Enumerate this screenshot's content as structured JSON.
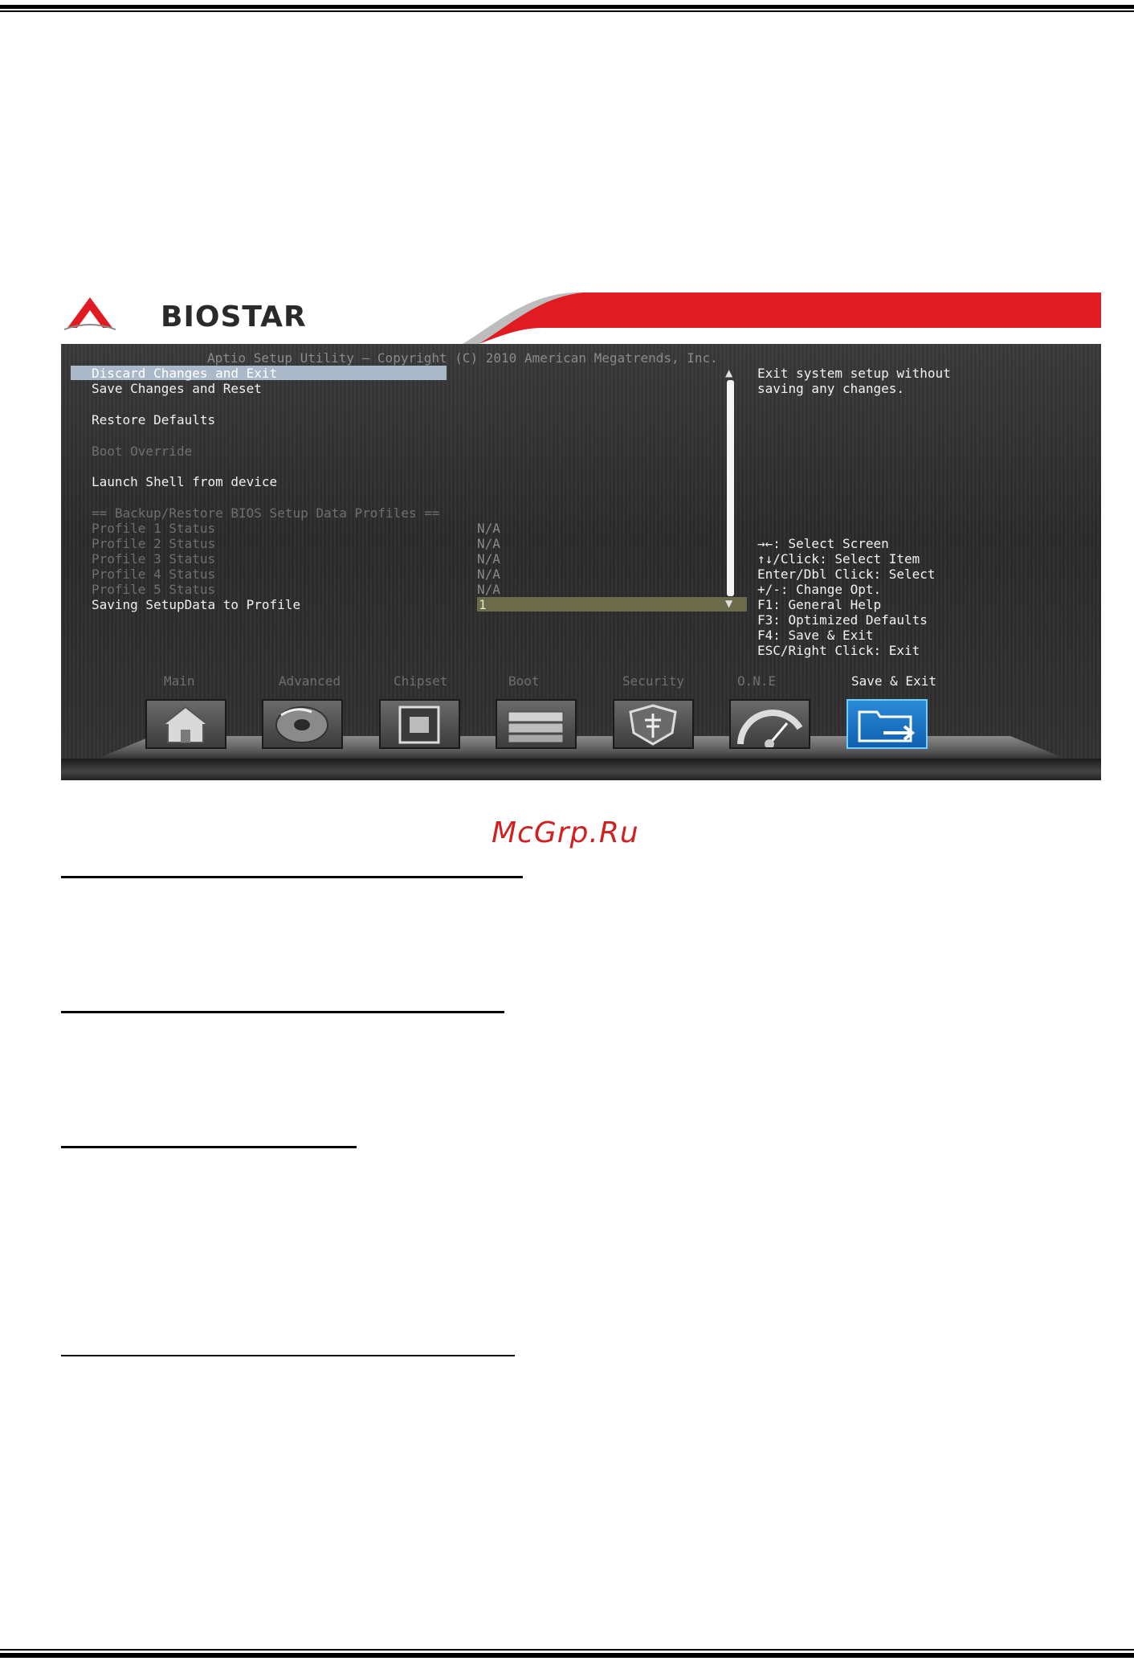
{
  "bios": {
    "brand": "BIOSTAR",
    "copyright": "Aptio Setup Utility – Copyright (C) 2010 American Megatrends, Inc.",
    "menu": {
      "discard": "Discard Changes and Exit",
      "save_reset": "Save Changes and Reset",
      "restore_defaults": "Restore Defaults",
      "boot_override": "Boot Override",
      "launch_shell": "Launch Shell from device",
      "profiles_header": "== Backup/Restore BIOS Setup Data Profiles ==",
      "profile1": "Profile 1 Status",
      "profile2": "Profile 2 Status",
      "profile3": "Profile 3 Status",
      "profile4": "Profile 4 Status",
      "profile5": "Profile 5 Status",
      "saving": "Saving SetupData to Profile"
    },
    "values": {
      "profile1": "N/A",
      "profile2": "N/A",
      "profile3": "N/A",
      "profile4": "N/A",
      "profile5": "N/A",
      "saving": "1"
    },
    "help": {
      "line1": "Exit system setup without",
      "line2": "saving any changes."
    },
    "keys": {
      "select_screen": "→←: Select Screen",
      "select_item": "↑↓/Click: Select Item",
      "enter": "Enter/Dbl Click: Select",
      "change": "+/-: Change Opt.",
      "f1": "F1: General Help",
      "f3": "F3: Optimized Defaults",
      "f4": "F4: Save & Exit",
      "esc": "ESC/Right Click: Exit"
    },
    "tabs": {
      "main": "Main",
      "advanced": "Advanced",
      "chipset": "Chipset",
      "boot": "Boot",
      "security": "Security",
      "one": "O.N.E",
      "save_exit": "Save & Exit"
    },
    "icons": [
      "home-icon",
      "disc-icon",
      "chip-icon",
      "drives-icon",
      "shield-cross-icon",
      "gauge-icon",
      "folder-exit-icon"
    ],
    "colors": {
      "highlight": "#a9b9c9",
      "accent_red": "#e11b22",
      "active_tab": "#1a7fd0"
    }
  },
  "watermark": "McGrp.Ru"
}
